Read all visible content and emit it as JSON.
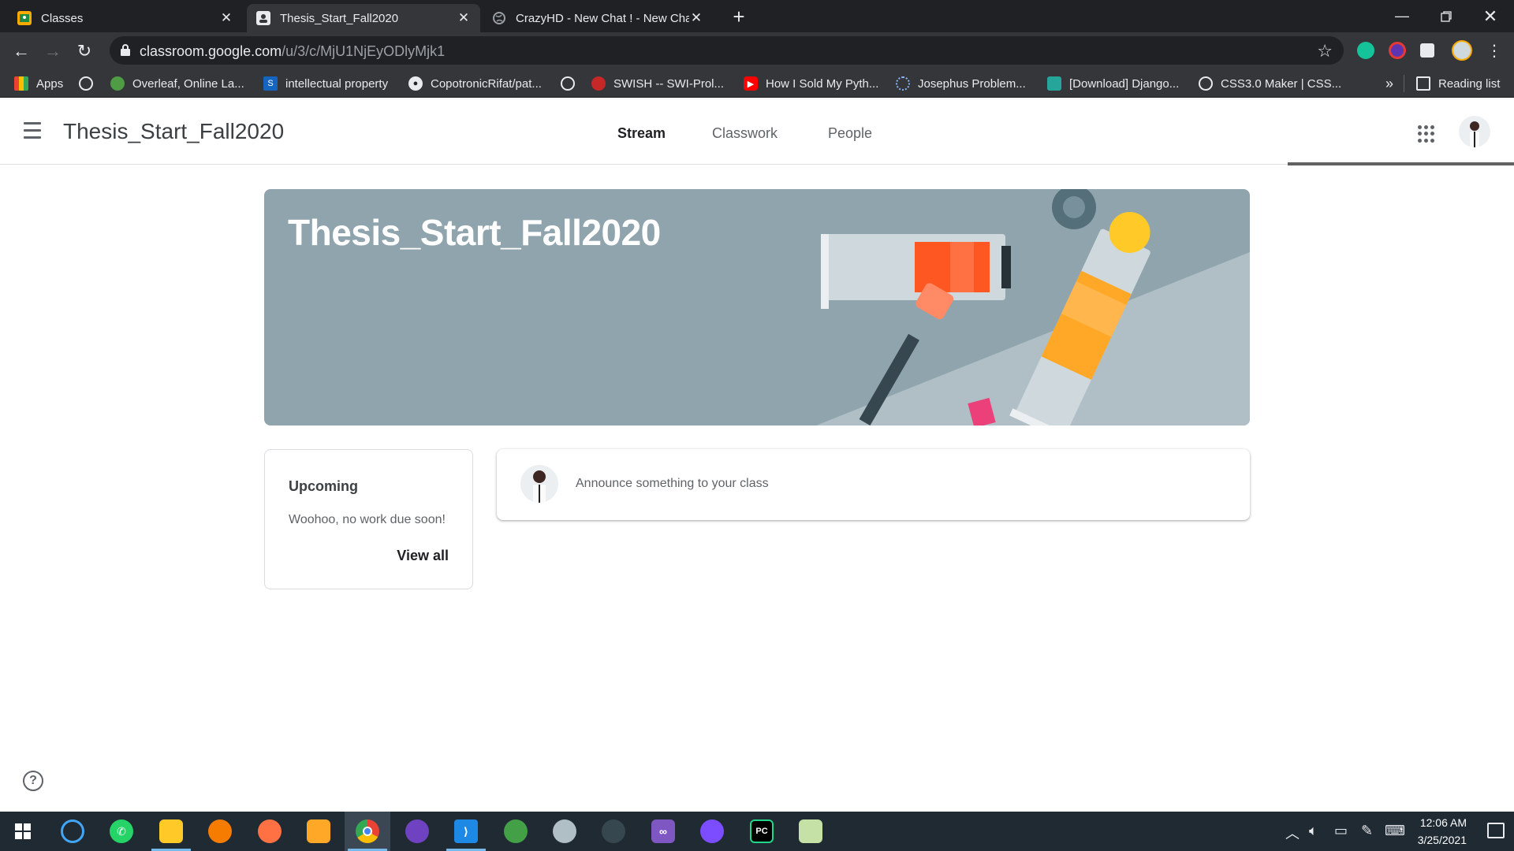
{
  "browser": {
    "tabs": [
      {
        "title": "Classes",
        "icon": "classroom-icon",
        "active": false
      },
      {
        "title": "Thesis_Start_Fall2020",
        "icon": "classroom-person-icon",
        "active": true
      },
      {
        "title": "CrazyHD - New Chat ! - New Cha",
        "icon": "globe-icon",
        "active": false
      }
    ],
    "url_host": "classroom.google.com",
    "url_path": "/u/3/c/MjU1NjEyODlyMjk1",
    "bookmarks": [
      {
        "label": "Apps",
        "icon": "apps-grid-icon"
      },
      {
        "label": "",
        "icon": "globe-icon"
      },
      {
        "label": "Overleaf, Online La...",
        "icon": "overleaf-icon"
      },
      {
        "label": "intellectual property",
        "icon": "s-icon"
      },
      {
        "label": "CopotronicRifat/pat...",
        "icon": "github-icon"
      },
      {
        "label": "",
        "icon": "globe-icon"
      },
      {
        "label": "SWISH -- SWI-Prol...",
        "icon": "swish-icon"
      },
      {
        "label": "How I Sold My Pyth...",
        "icon": "youtube-icon"
      },
      {
        "label": "Josephus Problem...",
        "icon": "loading-icon"
      },
      {
        "label": "[Download] Django...",
        "icon": "django-icon"
      },
      {
        "label": "CSS3.0 Maker | CSS...",
        "icon": "globe-icon"
      }
    ],
    "overflow_label": "»",
    "reading_list_label": "Reading list"
  },
  "appbar": {
    "class_title": "Thesis_Start_Fall2020",
    "tabs": [
      {
        "label": "Stream",
        "active": true
      },
      {
        "label": "Classwork",
        "active": false
      },
      {
        "label": "People",
        "active": false
      }
    ]
  },
  "banner": {
    "title": "Thesis_Start_Fall2020",
    "background_color": "#90a4ae"
  },
  "upcoming": {
    "title": "Upcoming",
    "empty_text": "Woohoo, no work due soon!",
    "view_all_label": "View all"
  },
  "announce": {
    "placeholder": "Announce something to your class"
  },
  "help": {
    "label": "?"
  },
  "taskbar": {
    "apps": [
      "windows-start-icon",
      "search-cortana-icon",
      "whatsapp-icon",
      "file-explorer-icon",
      "brave-icon",
      "firefox-icon",
      "photo-app-icon",
      "chrome-icon",
      "github-desktop-icon",
      "vscode-icon",
      "earth-icon",
      "paint-icon",
      "inkscape-icon",
      "visual-studio-icon",
      "messenger-icon",
      "pycharm-icon",
      "notepad-icon"
    ],
    "time": "12:06 AM",
    "date": "3/25/2021"
  },
  "colors": {
    "chrome_dark": "#202124",
    "chrome_toolbar": "#35363a",
    "banner": "#90a4ae",
    "taskbar": "#1f2a33"
  }
}
